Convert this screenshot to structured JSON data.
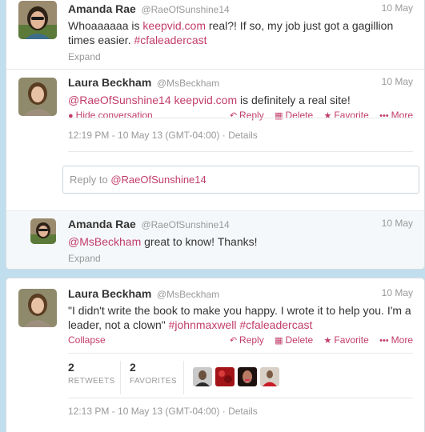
{
  "tweet1": {
    "name": "Amanda Rae",
    "handle": "@RaeOfSunshine14",
    "date": "10 May",
    "text_before": "Whoaaaaaa is ",
    "link": "keepvid.com",
    "text_after": " real?! If so, my job just got a gagillion times easier. ",
    "hashtag": "#cfaleadercast",
    "expand": "Expand"
  },
  "tweet2": {
    "name": "Laura Beckham",
    "handle": "@MsBeckham",
    "date": "10 May",
    "mention": "@RaeOfSunshine14",
    "link": "keepvid.com",
    "text_after": " is definitely a real site!",
    "hide_conversation": "Hide conversation",
    "reply": "Reply",
    "delete": "Delete",
    "favorite": "Favorite",
    "more": "More",
    "timestamp": "12:19 PM - 10 May 13 (GMT-04:00)",
    "details": "Details",
    "reply_prefix": "Reply to ",
    "reply_mention": "@RaeOfSunshine14"
  },
  "tweet3": {
    "name": "Amanda Rae",
    "handle": "@RaeOfSunshine14",
    "date": "10 May",
    "mention": "@MsBeckham",
    "text_after": " great to know! Thanks!",
    "expand": "Expand"
  },
  "tweet4": {
    "name": "Laura Beckham",
    "handle": "@MsBeckham",
    "date": "10 May",
    "text": "\"I didn't write the book to make you happy. I wrote it to help you. I'm a leader, not a clown\" ",
    "hashtag1": "#johnmaxwell",
    "hashtag2": "#cfaleadercast",
    "collapse": "Collapse",
    "reply": "Reply",
    "delete": "Delete",
    "favorite": "Favorite",
    "more": "More",
    "retweets_count": "2",
    "retweets_label": "RETWEETS",
    "favorites_count": "2",
    "favorites_label": "FAVORITES",
    "timestamp": "12:13 PM - 10 May 13 (GMT-04:00)",
    "details": "Details"
  },
  "colors": {
    "background": "#c0deed",
    "link": "#c23d6b",
    "muted": "#999999",
    "text": "#333333"
  }
}
